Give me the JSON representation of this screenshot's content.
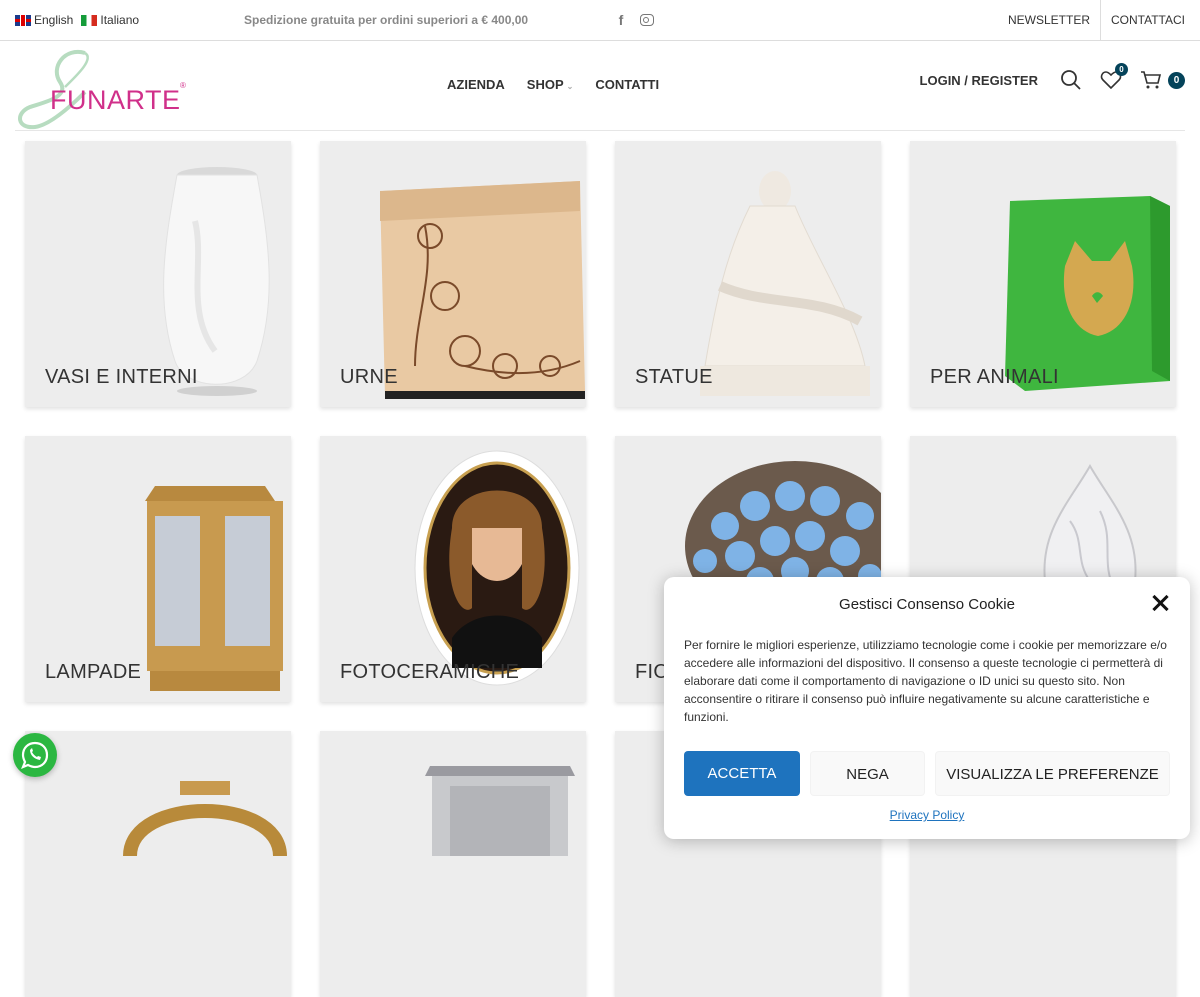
{
  "topbar": {
    "languages": [
      {
        "label": "English",
        "flag": "uk"
      },
      {
        "label": "Italiano",
        "flag": "it"
      }
    ],
    "shipping_text": "Spedizione gratuita per ordini superiori a € 400,00",
    "socials": [
      "facebook-icon",
      "instagram-icon"
    ],
    "newsletter": "NEWSLETTER",
    "contact": "CONTATTACI"
  },
  "header": {
    "logo_text": "FUNARTE",
    "logo_mark": "®",
    "nav": [
      {
        "label": "AZIENDA"
      },
      {
        "label": "SHOP",
        "has_dropdown": true
      },
      {
        "label": "CONTATTI"
      }
    ],
    "login": "LOGIN / REGISTER",
    "wishlist_count": "0",
    "cart_count": "0",
    "brand_color": "#d0308a",
    "badge_color": "#04435a"
  },
  "categories": [
    {
      "label": "VASI E INTERNI"
    },
    {
      "label": "URNE"
    },
    {
      "label": "STATUE"
    },
    {
      "label": "PER ANIMALI"
    },
    {
      "label": "LAMPADE"
    },
    {
      "label": "FOTOCERAMICHE"
    },
    {
      "label": "FIORI"
    },
    {
      "label": ""
    },
    {
      "label": ""
    },
    {
      "label": ""
    },
    {
      "label": ""
    },
    {
      "label": ""
    }
  ],
  "cookie": {
    "title": "Gestisci Consenso Cookie",
    "text": "Per fornire le migliori esperienze, utilizziamo tecnologie come i cookie per memorizzare e/o accedere alle informazioni del dispositivo. Il consenso a queste tecnologie ci permetterà di elaborare dati come il comportamento di navigazione o ID unici su questo sito. Non acconsentire o ritirare il consenso può influire negativamente su alcune caratteristiche e funzioni.",
    "accept": "ACCETTA",
    "deny": "NEGA",
    "preferences": "VISUALIZZA LE PREFERENZE",
    "privacy": "Privacy Policy",
    "accent_color": "#1e73be"
  },
  "whatsapp": {
    "icon": "whatsapp-icon",
    "color": "#2bb741"
  }
}
